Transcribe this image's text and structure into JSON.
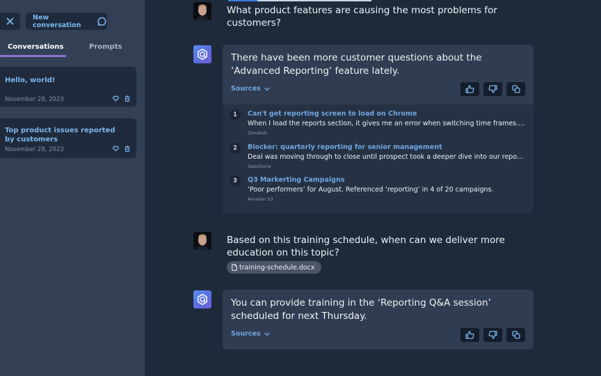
{
  "sidebar": {
    "close_icon": "close-icon",
    "new_conversation_label": "New conversation",
    "new_conversation_icon": "chat-bubble-icon",
    "tabs": [
      {
        "label": "Conversations",
        "active": true
      },
      {
        "label": "Prompts",
        "active": false
      }
    ],
    "conversations": [
      {
        "title": "Hello, world!",
        "date": "November 28, 2023"
      },
      {
        "title": "Top product issues reported by customers",
        "date": "November 28, 2023"
      }
    ],
    "item_icons": [
      "heart-icon",
      "trash-icon"
    ]
  },
  "chat": {
    "messages": [
      {
        "role": "user",
        "text": "What product features are causing the most problems for customers?"
      },
      {
        "role": "assistant",
        "text": "There have been more customer questions about the ‘Advanced Reporting’ feature lately.",
        "sources_label": "Sources",
        "sources_expanded": true,
        "sources": [
          {
            "number": "1",
            "title": "Can't get reporting screen to load on Chrome",
            "snippet": "When I load the reports section, it gives me an error when switching time frames. ...",
            "origin": "Zendesk"
          },
          {
            "number": "2",
            "title": "Blocker: quarterly reporting for senior management",
            "snippet": "Deal was moving through to close until prospect took a deeper dive into our reporting...",
            "origin": "Salesforce"
          },
          {
            "number": "3",
            "title": "Q3 Markerting Campaigns",
            "snippet": "‘Poor performers’ for August. Referenced ‘reporting’ in 4 of 20 campaigns.",
            "origin": "Amazon S3"
          }
        ]
      },
      {
        "role": "user",
        "text": "Based on this training schedule, when can we deliver more education on this topic?",
        "attachment": "training-schedule.docx"
      },
      {
        "role": "assistant",
        "text": "You can provide training in the ‘Reporting Q&A session’ scheduled for next Thursday.",
        "sources_label": "Sources",
        "sources_expanded": false
      }
    ],
    "feedback_icons": [
      "thumbs-up-icon",
      "thumbs-down-icon",
      "copy-icon"
    ]
  },
  "colors": {
    "accent_link": "#6fa6e0",
    "tab_underline": "#8f73d6",
    "sidebar_bg": "#333f55",
    "main_bg": "#1e2a3a",
    "card_bg": "#303c51"
  }
}
